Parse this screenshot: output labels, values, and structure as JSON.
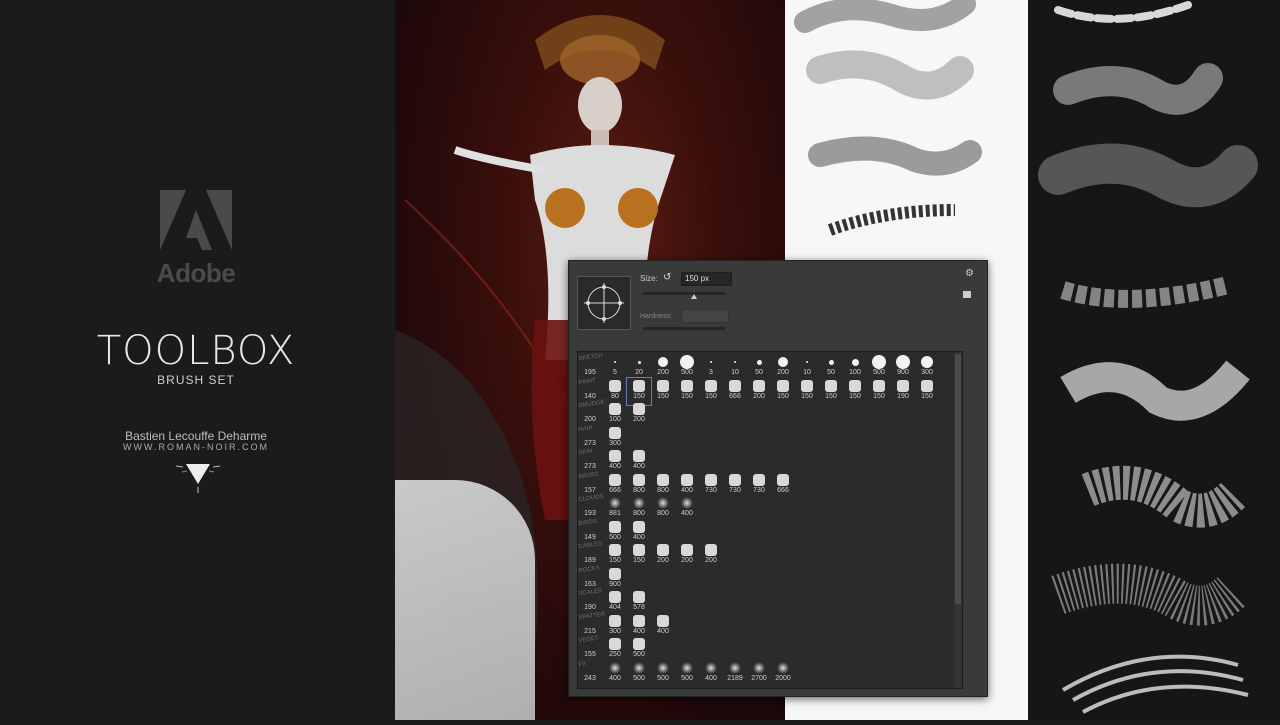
{
  "branding": {
    "adobe_word": "Adobe",
    "title": "TOOLBOX",
    "subtitle": "BRUSH SET",
    "author": "Bastien Lecouffe Deharme",
    "website": "WWW.ROMAN-NOIR.COM"
  },
  "panel": {
    "size_label": "Size:",
    "size_value": "150 px",
    "hardness_label": "Hardness:",
    "rows": [
      {
        "label": "SKETCH",
        "values": [
          "195",
          "5",
          "20",
          "200",
          "500",
          "3",
          "10",
          "50",
          "200",
          "10",
          "50",
          "100",
          "500",
          "900",
          "300"
        ]
      },
      {
        "label": "PAINT",
        "values": [
          "140",
          "80",
          "150",
          "150",
          "150",
          "150",
          "666",
          "200",
          "150",
          "150",
          "150",
          "150",
          "150",
          "190",
          "150"
        ]
      },
      {
        "label": "SMUDGE",
        "values": [
          "200",
          "100",
          "200"
        ]
      },
      {
        "label": "HAIR",
        "values": [
          "273",
          "300"
        ]
      },
      {
        "label": "SKIN",
        "values": [
          "273",
          "400",
          "400"
        ]
      },
      {
        "label": "WEIRD",
        "values": [
          "157",
          "666",
          "800",
          "800",
          "400",
          "730",
          "730",
          "730",
          "666"
        ]
      },
      {
        "label": "CLOUDS",
        "values": [
          "193",
          "881",
          "800",
          "800",
          "400"
        ]
      },
      {
        "label": "BIRDS",
        "values": [
          "149",
          "500",
          "400"
        ]
      },
      {
        "label": "CABLES",
        "values": [
          "189",
          "150",
          "150",
          "200",
          "200",
          "200"
        ]
      },
      {
        "label": "ROCKS",
        "values": [
          "163",
          "900"
        ]
      },
      {
        "label": "SCALES",
        "values": [
          "190",
          "404",
          "578"
        ]
      },
      {
        "label": "SPATTER",
        "values": [
          "215",
          "300",
          "400",
          "400"
        ]
      },
      {
        "label": "VEGET",
        "values": [
          "155",
          "250",
          "500"
        ]
      },
      {
        "label": "FX",
        "values": [
          "243",
          "400",
          "500",
          "500",
          "500",
          "400",
          "2189",
          "2700",
          "2000"
        ]
      }
    ]
  }
}
